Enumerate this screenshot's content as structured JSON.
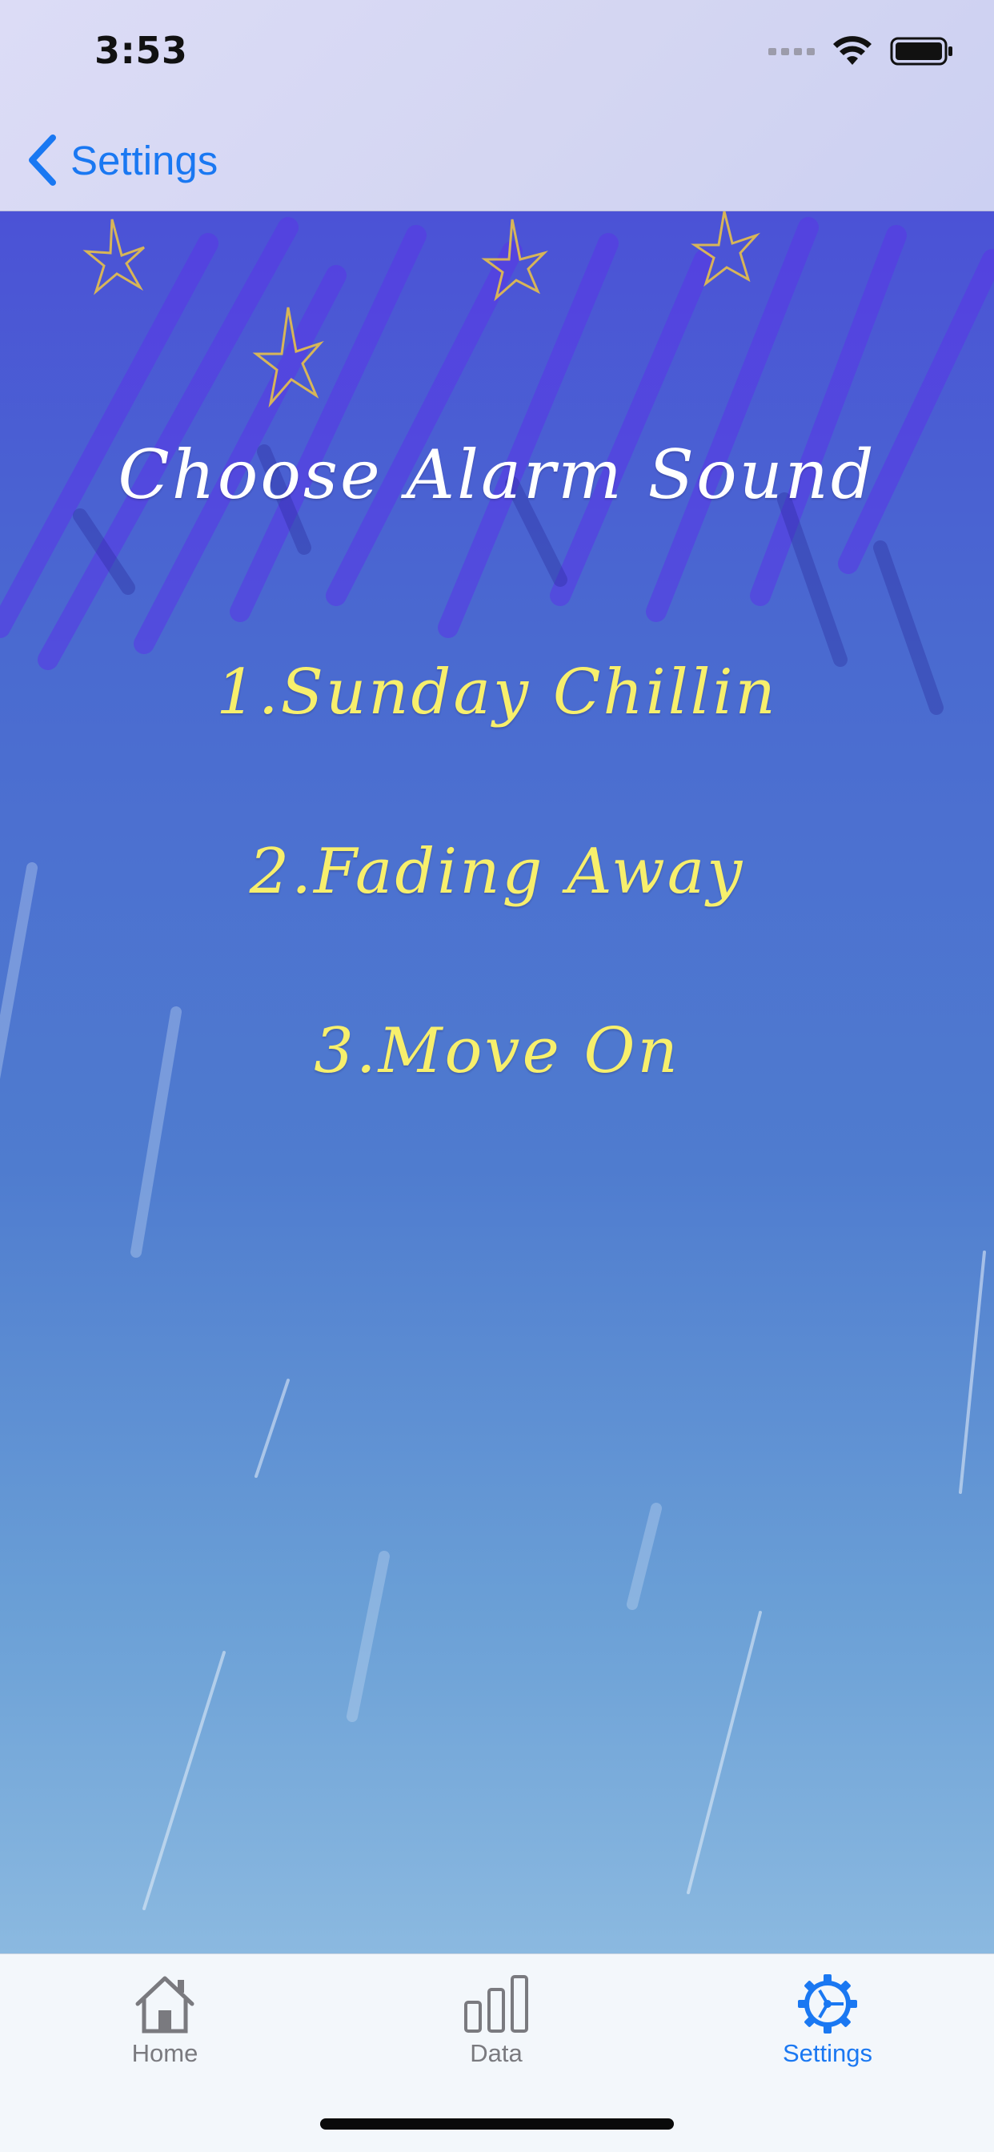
{
  "status_bar": {
    "time": "3:53"
  },
  "nav": {
    "back_label": "Settings"
  },
  "main": {
    "title": "Choose Alarm Sound",
    "options": [
      {
        "label": "1.Sunday Chillin"
      },
      {
        "label": "2.Fading Away"
      },
      {
        "label": "3.Move On"
      }
    ]
  },
  "tabbar": {
    "tabs": [
      {
        "label": "Home",
        "icon": "house-icon",
        "selected": false
      },
      {
        "label": "Data",
        "icon": "bar-chart-icon",
        "selected": false
      },
      {
        "label": "Settings",
        "icon": "gear-icon",
        "selected": true
      }
    ]
  },
  "colors": {
    "accent": "#1a78f2",
    "option_text": "#f7ef6c",
    "title_text": "#ffffff",
    "inactive_tab": "#7a7a7f"
  }
}
